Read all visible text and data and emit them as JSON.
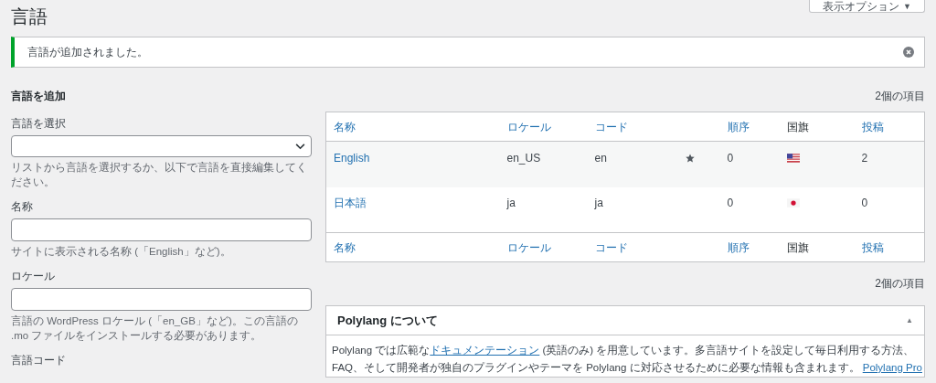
{
  "screen_options": {
    "label": "表示オプション",
    "caret": "▼"
  },
  "title": "言語",
  "notice": {
    "message": "言語が追加されました。"
  },
  "add_form": {
    "heading": "言語を追加",
    "fields": [
      {
        "kind": "select",
        "label": "言語を選択",
        "help": "リストから言語を選択するか、以下で言語を直接編集してください。"
      },
      {
        "kind": "text",
        "label": "名称",
        "help": "サイトに表示される名称 (「English」など)。"
      },
      {
        "kind": "text",
        "label": "ロケール",
        "help": "言語の WordPress ロケール (「en_GB」など)。この言語の .mo ファイルをインストールする必要があります。"
      },
      {
        "label": "言語コード"
      }
    ]
  },
  "table": {
    "item_count_top": "2個の項目",
    "item_count_bottom": "2個の項目",
    "columns": [
      {
        "label": "名称",
        "sortable": true
      },
      {
        "label": "ロケール",
        "sortable": true
      },
      {
        "label": "コード",
        "sortable": true
      },
      {
        "label": "順序",
        "sortable": true
      },
      {
        "label": "国旗",
        "sortable": false
      },
      {
        "label": "投稿",
        "sortable": true
      }
    ],
    "footer_columns": [
      {
        "label": "名称",
        "sortable": true
      },
      {
        "label": "ロケール",
        "sortable": true
      },
      {
        "label": "コード",
        "sortable": true
      },
      {
        "label": "順序",
        "sortable": true
      },
      {
        "label": "国旗",
        "sortable": false
      },
      {
        "label": "投稿",
        "sortable": true
      }
    ],
    "rows": [
      {
        "name": "English",
        "locale": "en_US",
        "code": "en",
        "default": true,
        "order": "0",
        "flag": {
          "kind": "us"
        },
        "posts": "2"
      },
      {
        "name": "日本語",
        "locale": "ja",
        "code": "ja",
        "default": false,
        "order": "0",
        "flag": {
          "kind": "jp"
        },
        "posts": "0"
      }
    ]
  },
  "about_box": {
    "title": "Polylang について",
    "toggle": "▲",
    "expanded": true,
    "body": [
      {
        "kind": "text",
        "text": "Polylang では広範な"
      },
      {
        "kind": "link",
        "text": "ドキュメンテーション"
      },
      {
        "kind": "text",
        "text": " (英語のみ) を用意しています。多言語サイトを設定して毎日利用する方法、"
      },
      {
        "kind": "break"
      },
      {
        "kind": "text",
        "text": "FAQ、そして開発者が独自のプラグインやテーマを Polylang に対応させるために必要な情報も含まれます。 "
      },
      {
        "kind": "link",
        "text": "Polylang Pro"
      }
    ]
  }
}
